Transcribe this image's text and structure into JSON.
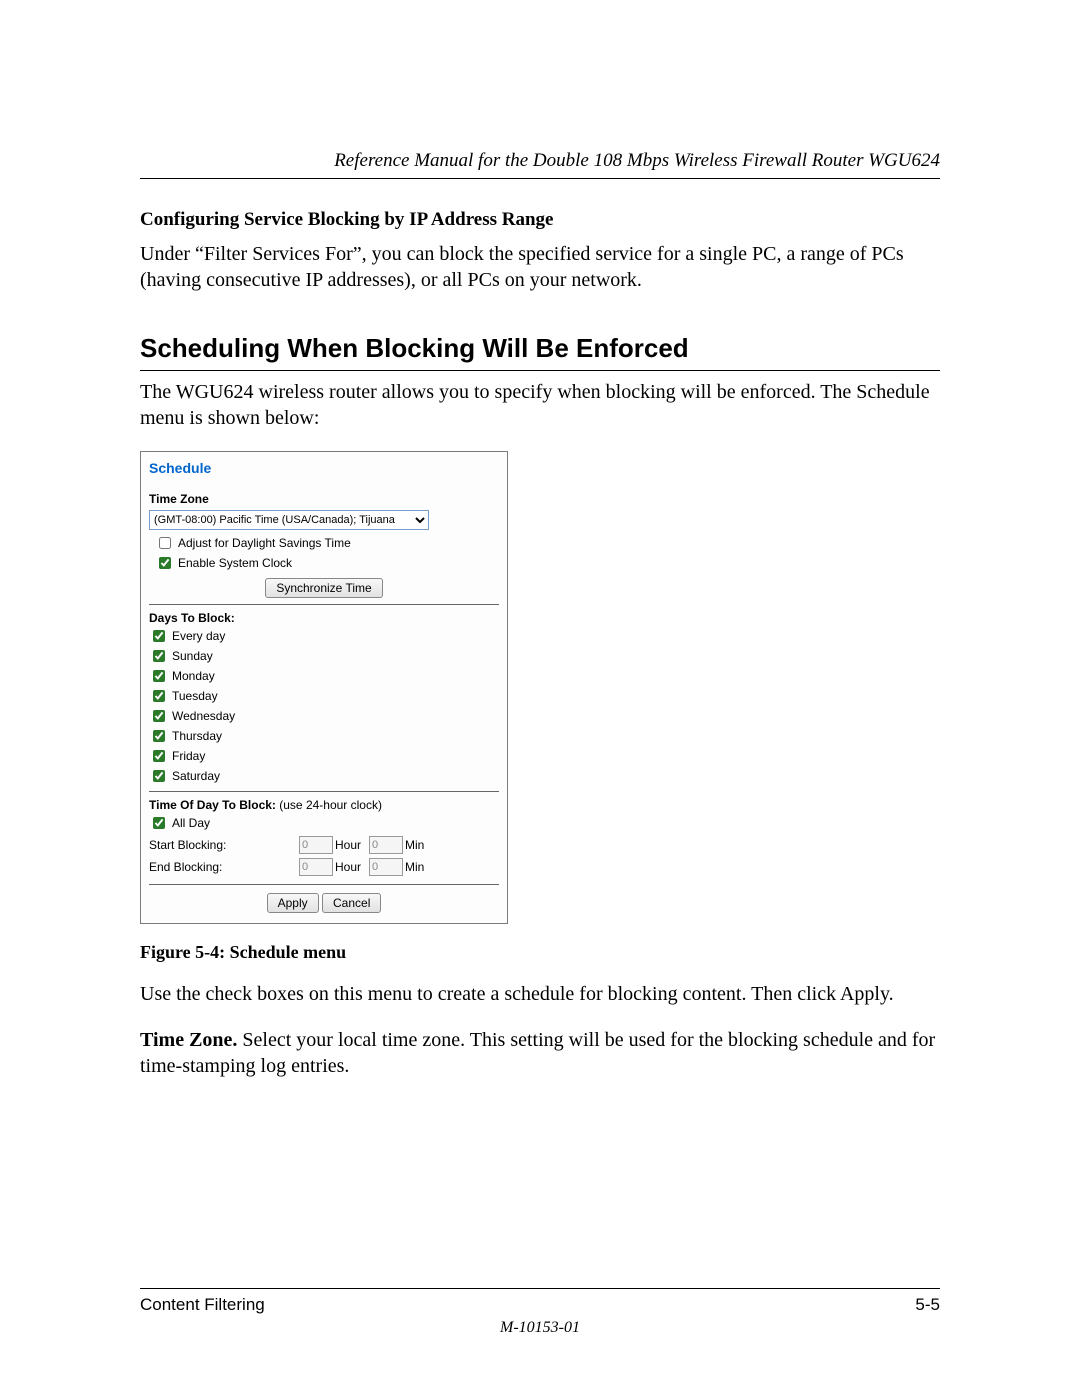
{
  "header": {
    "title": "Reference Manual for the Double 108 Mbps Wireless Firewall Router WGU624"
  },
  "section1": {
    "heading": "Configuring Service Blocking by IP Address Range",
    "para": "Under “Filter Services For”, you can block the specified service for a single PC, a range of PCs (having consecutive IP addresses), or all PCs on your network."
  },
  "section2": {
    "heading": "Scheduling When Blocking Will Be Enforced",
    "para": "The WGU624 wireless router allows you to specify when blocking will be enforced. The Schedule menu is shown below:"
  },
  "shot": {
    "title": "Schedule",
    "tz_label": "Time Zone",
    "tz_value": "(GMT-08:00) Pacific Time (USA/Canada); Tijuana",
    "adjust_dst": "Adjust for Daylight Savings Time",
    "enable_clock": "Enable System Clock",
    "sync_btn": "Synchronize Time",
    "days_label": "Days To Block:",
    "days": [
      "Every day",
      "Sunday",
      "Monday",
      "Tuesday",
      "Wednesday",
      "Thursday",
      "Friday",
      "Saturday"
    ],
    "tod_label": "Time Of Day To Block:",
    "tod_note": "(use 24-hour clock)",
    "all_day": "All Day",
    "start_label": "Start Blocking:",
    "end_label": "End Blocking:",
    "hour": "Hour",
    "min": "Min",
    "zero": "0",
    "apply": "Apply",
    "cancel": "Cancel"
  },
  "caption": "Figure 5-4:  Schedule menu",
  "after": {
    "p1": "Use the check boxes on this menu to create a schedule for blocking content. Then click Apply.",
    "p2a": "Time Zone.",
    "p2b": " Select your local time zone. This setting will be used for the blocking schedule and for time-stamping log entries."
  },
  "footer": {
    "left": "Content Filtering",
    "right": "5-5",
    "docnum": "M-10153-01"
  }
}
